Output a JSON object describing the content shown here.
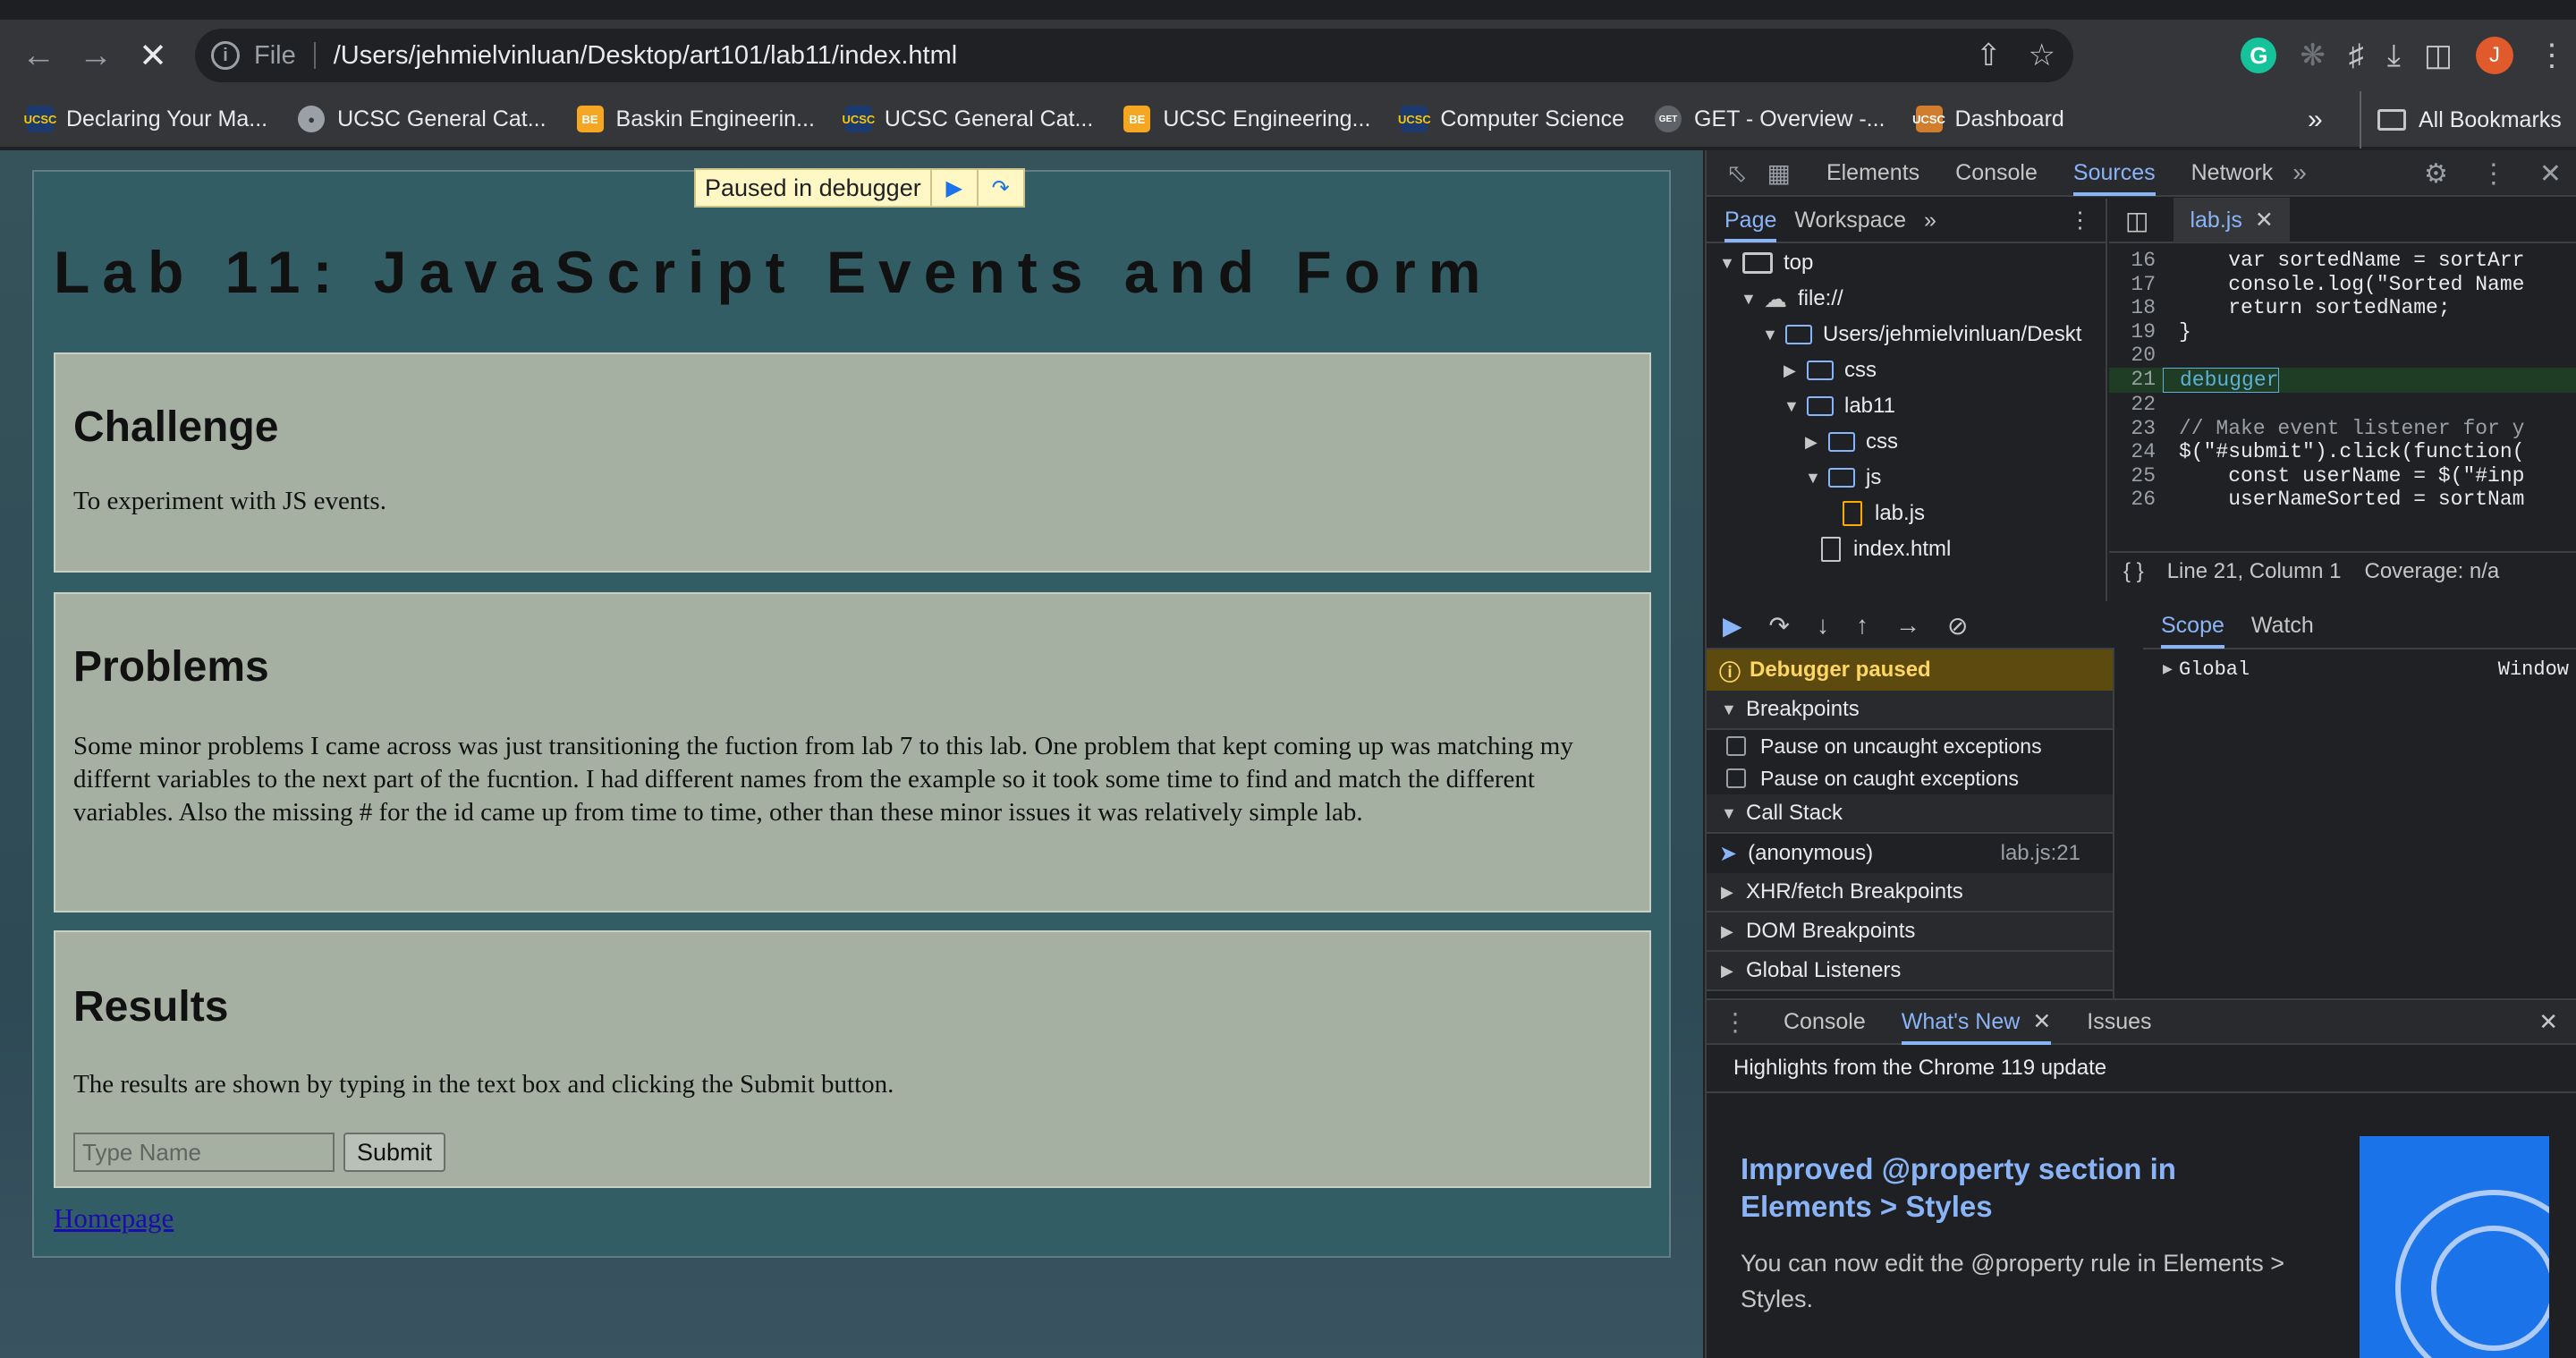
{
  "browser": {
    "file_label": "File",
    "url": "/Users/jehmielvinluan/Desktop/art101/lab11/index.html",
    "bookmarks": [
      {
        "label": "Declaring Your Ma...",
        "icon": "UCSC"
      },
      {
        "label": "UCSC General Cat...",
        "icon": "globe"
      },
      {
        "label": "Baskin Engineerin...",
        "icon": "BE"
      },
      {
        "label": "UCSC General Cat...",
        "icon": "UCSC"
      },
      {
        "label": "UCSC Engineering...",
        "icon": "BE"
      },
      {
        "label": "Computer Science",
        "icon": "UCSC"
      },
      {
        "label": "GET - Overview -...",
        "icon": "GET"
      },
      {
        "label": "Dashboard",
        "icon": "UCSC"
      }
    ],
    "bookmarks_more": "»",
    "all_bookmarks": "All Bookmarks",
    "profile_initial": "J",
    "ext_initial": "G"
  },
  "page": {
    "paused_label": "Paused in debugger",
    "title": "Lab 11: JavaScript Events and Form",
    "challenge_heading": "Challenge",
    "challenge_text": "To experiment with JS events.",
    "problems_heading": "Problems",
    "problems_text": "Some minor problems I came across was just transitioning the fuction from lab 7 to this lab. One problem that kept coming up was matching my differnt variables to the next part of the fucntion. I had different names from the example so it took some time to find and match the different variables. Also the missing # for the id came up from time to time, other than these minor issues it was relatively simple lab.",
    "results_heading": "Results",
    "results_text": "The results are shown by typing in the text box and clicking the Submit button.",
    "input_placeholder": "Type Name",
    "submit_label": "Submit",
    "homepage_link": "Homepage"
  },
  "devtools": {
    "tabs": [
      "Elements",
      "Console",
      "Sources",
      "Network"
    ],
    "active_tab": "Sources",
    "nav_subtabs": [
      "Page",
      "Workspace"
    ],
    "tree": {
      "top": "top",
      "origin": "file://",
      "users": "Users/jehmielvinluan/Deskt",
      "css1": "css",
      "lab11": "lab11",
      "css2": "css",
      "js": "js",
      "labjs": "lab.js",
      "index": "index.html"
    },
    "editor_tab": "lab.js",
    "code_lines": [
      {
        "n": "16",
        "code": "    var sortedName = sortArr"
      },
      {
        "n": "17",
        "code": "    console.log(\"Sorted Name"
      },
      {
        "n": "18",
        "code": "    return sortedName;"
      },
      {
        "n": "19",
        "code": "}"
      },
      {
        "n": "20",
        "code": ""
      },
      {
        "n": "21",
        "code": "debugger"
      },
      {
        "n": "22",
        "code": ""
      },
      {
        "n": "23",
        "code": "// Make event listener for y"
      },
      {
        "n": "24",
        "code": "$(\"#submit\").click(function("
      },
      {
        "n": "25",
        "code": "    const userName = $(\"#inp"
      },
      {
        "n": "26",
        "code": "    userNameSorted = sortNam"
      }
    ],
    "status_position": "Line 21, Column 1",
    "status_coverage": "Coverage: n/a",
    "debugger_paused": "Debugger paused",
    "breakpoints": "Breakpoints",
    "pause_uncaught": "Pause on uncaught exceptions",
    "pause_caught": "Pause on caught exceptions",
    "call_stack": "Call Stack",
    "stack_fn": "(anonymous)",
    "stack_loc": "lab.js:21",
    "xhr_breakpoints": "XHR/fetch Breakpoints",
    "dom_breakpoints": "DOM Breakpoints",
    "global_listeners": "Global Listeners",
    "scope_tab": "Scope",
    "watch_tab": "Watch",
    "scope_global": "Global",
    "scope_global_value": "Window",
    "drawer_tabs": [
      "Console",
      "What's New",
      "Issues"
    ],
    "drawer_active": "What's New",
    "whatsnew_header": "Highlights from the Chrome 119 update",
    "whatsnew_title": "Improved @property section in Elements > Styles",
    "whatsnew_desc": "You can now edit the @property rule in Elements > Styles."
  },
  "colors": {
    "accent": "#8ab4f8",
    "page_bg": "#335d64",
    "card_bg": "#a5b0a3",
    "paused_banner": "#5c4a0f"
  }
}
